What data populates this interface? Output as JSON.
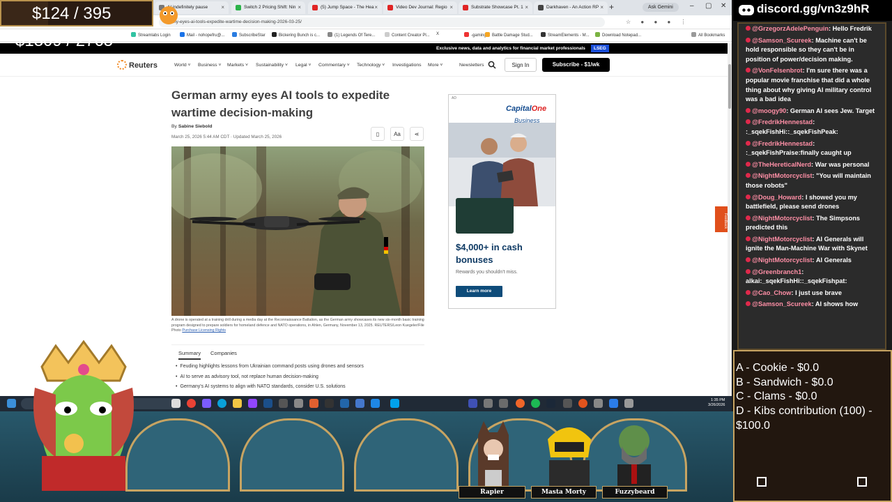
{
  "browser": {
    "tabs": [
      {
        "label": "AI indefinitely pause"
      },
      {
        "label": "Switch 2 Pricing Shift: Nin"
      },
      {
        "label": "(5) Jump Space - The Hea"
      },
      {
        "label": "Video Dev Journal: Regio"
      },
      {
        "label": "Substrate Showcase Pt. 1"
      },
      {
        "label": "Darkhaven - An Action RP"
      }
    ],
    "ask_gemini": "Ask Gemini",
    "url": "...army-eyes-ai-tools-expedite-wartime-decision-making-2026-03-25/",
    "bookmarks": [
      "Streamlabs Login",
      "Mail - nohopefru@...",
      "SubscribeStar",
      "Bickering Bunch is c...",
      "(1) Legends Of Tere...",
      "Content Creator Pl...",
      "-gaming",
      "Battle Damage Stud...",
      "StreamElements - M...",
      "Download Notepad...",
      "All Bookmarks"
    ]
  },
  "reuters": {
    "banner": "Exclusive news, data and analytics for financial market professionals",
    "banner_badge": "LSEG",
    "logo": "Reuters",
    "nav": [
      "World",
      "Business",
      "Markets",
      "Sustainability",
      "Legal",
      "Commentary",
      "Technology",
      "Investigations",
      "More"
    ],
    "newsletters": "Newsletters",
    "sign_in": "Sign In",
    "subscribe": "Subscribe - $1/wk",
    "headline": "German army eyes AI tools to expedite wartime decision-making",
    "by": "By",
    "author": "Sabine Siebold",
    "dateline": "March 25, 2026 5:44 AM CDT · Updated March 25, 2026",
    "font_button": "Aa",
    "caption": "A drone is operated at a training drill during a media day at the Reconnaissance Battalion, as the German army showcases its new six-month basic training program designed to prepare soldiers for homeland defence and NATO operations, in Ahlen, Germany, November 13, 2025. REUTERS/Leon Kuegeler/File Photo",
    "caption_link": "Purchase Licensing Rights",
    "summary_tab": "Summary",
    "companies_tab": "Companies",
    "bullets": [
      "Feuding highlights lessons from Ukrainian command posts using drones and sensors",
      "AI to serve as advisory tool, not replace human decision-making",
      "Germany's AI systems to align with NATO standards, consider U.S. solutions"
    ],
    "feedback": "Feedback"
  },
  "ad": {
    "label": "AD",
    "brand": "Capital",
    "brand_red": "One",
    "sub": "Business",
    "headline": "$4,000+ in cash bonuses",
    "small": "Rewards you shouldn't miss.",
    "cta": "Learn more"
  },
  "overlay": {
    "goal1": "$124 / 395",
    "goal1_progress": 0.31,
    "goal2": "$1309 / 2765",
    "discord": "discord.gg/vn3z9hR",
    "chat": [
      {
        "user": "@GrzegorzAdelePenguin",
        "text": "Hello Fredrik"
      },
      {
        "user": "@Samson_Scureek",
        "text": "Machine can't be hold responsible so they can't be in position of power/decision making."
      },
      {
        "user": "@VonFelsenbrot",
        "text": "I'm sure there was a popular movie franchise that did a whole thing about why giving AI military control was a bad idea"
      },
      {
        "user": "@moogy90",
        "text": "German AI sees Jew. Target"
      },
      {
        "user": "@FredrikHennestad",
        "text": ":_sqekFishHi::_sqekFishPeak:"
      },
      {
        "user": "@FredrikHennestad",
        "text": ":_sqekFishPraise:finally caught up"
      },
      {
        "user": "@TheHereticalNerd",
        "text": "War was personal"
      },
      {
        "user": "@NightMotorcyclist",
        "text": "\"You will maintain those robots\""
      },
      {
        "user": "@Doug_Howard",
        "text": "I showed you my battlefield, please send drones"
      },
      {
        "user": "@NightMotorcyclist",
        "text": "The Simpsons predicted this"
      },
      {
        "user": "@NightMotorcyclist",
        "text": "AI Generals will ignite the Man-Machine War with Skynet"
      },
      {
        "user": "@NightMotorcyclist",
        "text": "AI Generals"
      },
      {
        "user": "@Greenbranch1",
        "text": "alkai:_sqekFishHi::_sqekFishpat:"
      },
      {
        "user": "@Cao_Chow",
        "text": "I just use brave"
      },
      {
        "user": "@Samson_Scureek",
        "text": "AI shows how"
      }
    ],
    "poll": [
      "A - Cookie - $0.0",
      "B - Sandwich - $0.0",
      "C - Clams - $0.0",
      "D - Kibs contribution (100) - $100.0"
    ],
    "names": [
      "Rapier",
      "Masta Morty",
      "Fuzzybeard"
    ],
    "clock": "1:35 PM",
    "date": "3/26/2026"
  }
}
